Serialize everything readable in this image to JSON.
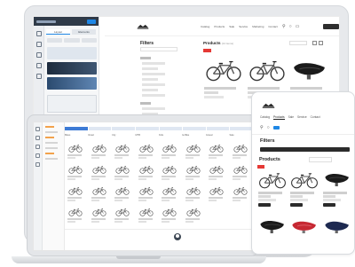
{
  "shop": {
    "filters_title": "Filters",
    "products_title": "Products",
    "products_count": "(12 items)",
    "nav_links": [
      "Catalog",
      "Products",
      "Sale",
      "Service",
      "Marketing",
      "Contact"
    ],
    "sale_badge": "SALE"
  },
  "builder": {
    "tabs": [
      "Layout",
      "Elements"
    ]
  },
  "admin_grid": {
    "columns": [
      "Bikes",
      "Road",
      "City",
      "MTB",
      "Kids",
      "E-Bike",
      "Gravel",
      "Sale"
    ]
  },
  "phone": {
    "nav_links": [
      "Catalog",
      "Products",
      "Sale",
      "Service",
      "Contact"
    ],
    "filters_title": "Filters",
    "products_title": "Products"
  },
  "icons": {
    "search": "search-icon",
    "cart": "cart-icon",
    "user": "user-icon"
  },
  "colors": {
    "accent": "#1f87e5",
    "sale": "#e53935",
    "saddle_red": "#c62832",
    "dark": "#2b2b2b"
  }
}
